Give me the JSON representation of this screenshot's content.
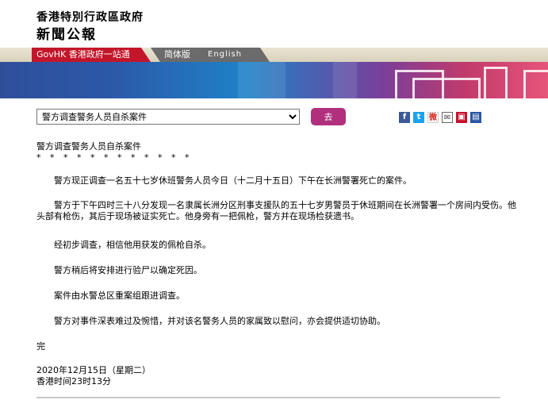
{
  "header": {
    "org_name": "香港特別行政區政府",
    "press_title": "新聞公報"
  },
  "nav": {
    "govhk_label": "GovHK 香港政府一站通",
    "simplified_label": "简体版",
    "english_label": "English"
  },
  "toolbar": {
    "selected_title": "警方调查警务人员自杀案件",
    "go_label": "去"
  },
  "share_icons": [
    "facebook-icon",
    "twitter-icon",
    "weibo-icon",
    "email-icon",
    "print-icon",
    "mobile-icon"
  ],
  "article": {
    "title": "警方调查警务人员自杀案件",
    "stars": "* * * * * * * * * * * *",
    "paragraphs": [
      "警方现正调查一名五十七岁休班警务人员今日（十二月十五日）下午在长洲警署死亡的案件。",
      "警方于下午四时三十八分发现一名隶属长洲分区刑事支援队的五十七岁男警员于休班期间在长洲警署一个房间内受伤。他头部有枪伤，其后于现场被证实死亡。他身旁有一把佩枪，警方并在现场检获遗书。",
      "经初步调查，相信他用获发的佩枪自杀。",
      "警方稍后将安排进行验尸以确定死因。",
      "案件由水警总区重案组跟进调查。",
      "警方对事件深表难过及惋惜，并对该名警务人员的家属致以慰问，亦会提供适切协助。"
    ],
    "end_mark": "完",
    "date": "2020年12月15日（星期二）",
    "time": "香港时间23时13分"
  },
  "colors": {
    "govhk_red": "#c4162a",
    "go_button": "#b0307e"
  }
}
